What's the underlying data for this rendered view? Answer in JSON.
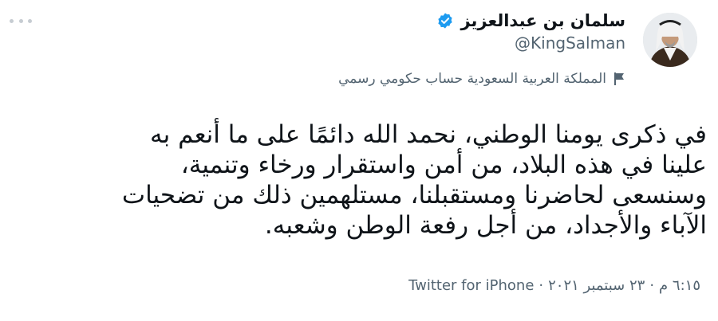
{
  "author": {
    "display_name": "سلمان بن عبدالعزيز",
    "handle": "@KingSalman",
    "verified": true
  },
  "label": {
    "text": "المملكة العربية السعودية حساب حكومي رسمي",
    "icon": "flag-icon"
  },
  "tweet": {
    "lines": [
      "في ذكرى يومنا الوطني، نحمد الله دائمًا على ما أنعم به",
      "علينا في هذه البلاد، من أمن واستقرار ورخاء وتنمية،",
      "وسنسعى لحاضرنا ومستقبلنا، مستلهمين ذلك من تضحيات",
      "الآباء والأجداد، من أجل رفعة الوطن وشعبه."
    ]
  },
  "meta": {
    "time": "٦:١٥ م",
    "date": "٢٣ سبتمبر ٢٠٢١",
    "separator": "·",
    "source": "Twitter for iPhone"
  },
  "colors": {
    "verified_blue": "#1d9bf0",
    "secondary_text": "#536471",
    "text": "#0f1419"
  }
}
